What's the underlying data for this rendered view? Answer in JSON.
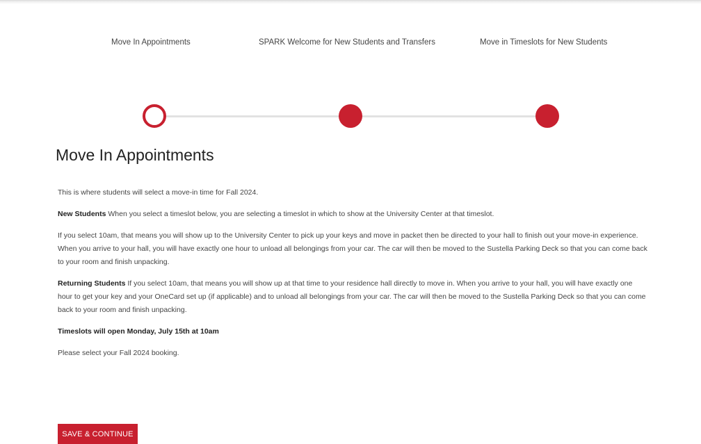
{
  "steps": [
    {
      "label": "Move In Appointments",
      "state": "current"
    },
    {
      "label": "SPARK Welcome for New Students and Transfers",
      "state": "upcoming"
    },
    {
      "label": "Move in Timeslots for New Students",
      "state": "upcoming"
    }
  ],
  "colors": {
    "accent": "#c8202f",
    "track": "#e2e2e2",
    "text": "#444444"
  },
  "main": {
    "title": "Move In Appointments",
    "intro": "This is where students will select a move-in time for Fall 2024.",
    "new_students_heading": "New Students",
    "new_students_text": " When you select a timeslot below, you are selecting a timeslot in which to show at the University Center at that timeslot.",
    "ten_am_text": "If you select 10am, that means you will show up to the University Center to pick up your keys and move in packet then be directed to your hall to finish out your move-in experience. When you arrive to your hall, you will have exactly one hour to unload all belongings from your car. The car will then be moved to the Sustella Parking Deck so that you can come back to your room and finish unpacking.",
    "returning_heading": "Returning Students",
    "returning_text": " If you select 10am, that means you will show up at that time to your residence hall directly to move in. When you arrive to your hall, you will have exactly one hour to get your key and your OneCard set up (if applicable) and to unload all belongings from your car. The car will then be moved to the Sustella Parking Deck so that you can come back to your room and finish unpacking.",
    "timeslots_notice": "Timeslots will open Monday, July 15th at 10am",
    "select_prompt": "Please select your Fall 2024 booking."
  },
  "actions": {
    "save_continue_label": "SAVE & CONTINUE"
  }
}
